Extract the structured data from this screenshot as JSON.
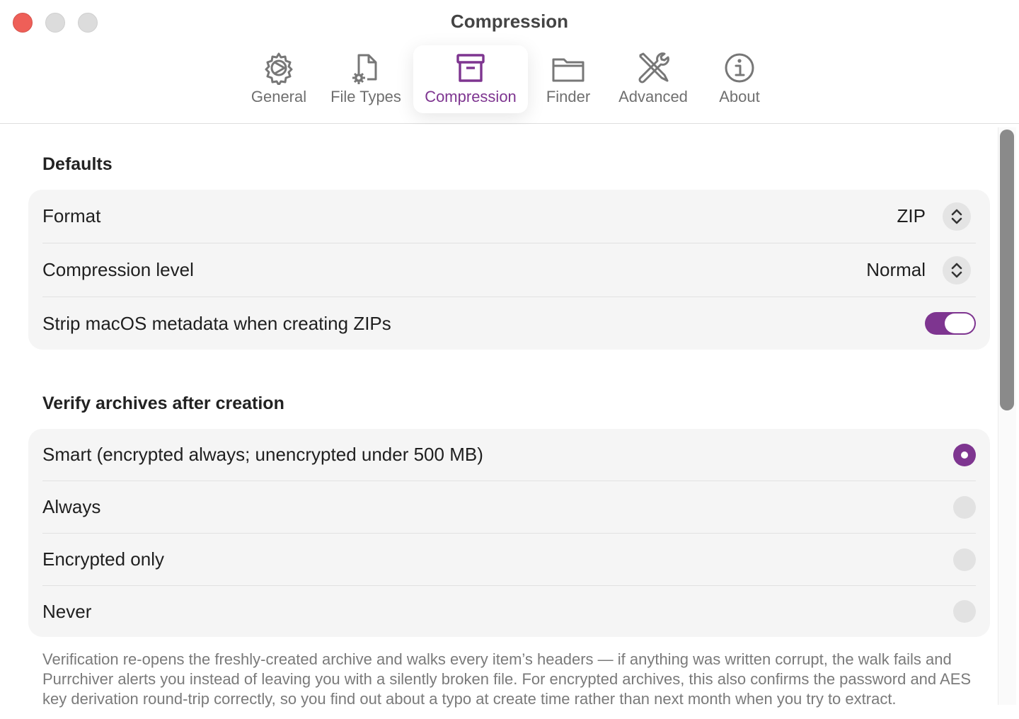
{
  "window": {
    "title": "Compression"
  },
  "tabs": [
    {
      "label": "General",
      "icon": "gear-icon"
    },
    {
      "label": "File Types",
      "icon": "document-gear-icon"
    },
    {
      "label": "Compression",
      "icon": "archive-box-icon",
      "selected": true
    },
    {
      "label": "Finder",
      "icon": "folder-icon"
    },
    {
      "label": "Advanced",
      "icon": "tools-icon"
    },
    {
      "label": "About",
      "icon": "info-icon"
    }
  ],
  "defaults": {
    "header": "Defaults",
    "format_label": "Format",
    "format_value": "ZIP",
    "level_label": "Compression level",
    "level_value": "Normal",
    "strip_label": "Strip macOS metadata when creating ZIPs",
    "strip_enabled": true
  },
  "verify": {
    "header": "Verify archives after creation",
    "options": [
      {
        "label": "Smart (encrypted always; unencrypted under 500 MB)",
        "selected": true
      },
      {
        "label": "Always",
        "selected": false
      },
      {
        "label": "Encrypted only",
        "selected": false
      },
      {
        "label": "Never",
        "selected": false
      }
    ],
    "footnote": "Verification re-opens the freshly-created archive and walks every item’s headers — if anything was written corrupt, the walk fails and Purrchiver alerts you instead of leaving you with a silently broken file. For encrypted archives, this also confirms the password and AES key derivation round-trip correctly, so you find out about a typo at create time rather than next month when you try to extract."
  },
  "colors": {
    "accent": "#7e3590",
    "close_button": "#ee5f58",
    "group_background": "#f5f5f5"
  }
}
